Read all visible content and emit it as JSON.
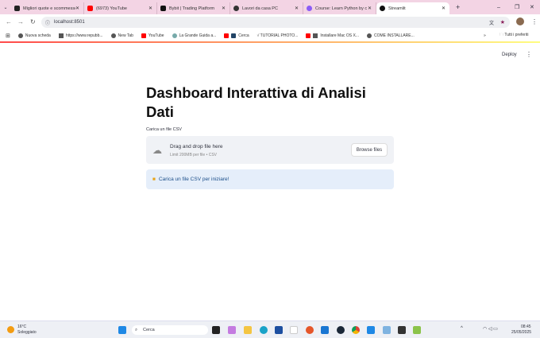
{
  "browser": {
    "tabs": [
      {
        "title": "Migliori quote e scommesse",
        "color": "#222"
      },
      {
        "title": "(6973) YouTube",
        "color": "#f00"
      },
      {
        "title": "Bybit | Trading Platform",
        "color": "#111"
      },
      {
        "title": "Lavori da casa PC",
        "color": "#333"
      },
      {
        "title": "Course: Learn Python by c",
        "color": "#8b5cf6"
      },
      {
        "title": "Streamlit",
        "color": "#111"
      }
    ],
    "url": "localhost:8501",
    "bookmarks": [
      "Nuova scheda",
      "https://www.repubb...",
      "New Tab",
      "YouTube",
      "La Grande Guida a...",
      "Cerca",
      "√ TUTORIAL PHOTO...",
      "Installare Mac OS X...",
      "COME INSTALLARE..."
    ],
    "all_bookmarks": "Tutti i preferiti"
  },
  "app": {
    "deploy": "Deploy",
    "title": "Dashboard Interattiva di Analisi Dati",
    "uploader_label": "Carica un file CSV",
    "drag_text": "Drag and drop file here",
    "limit_text": "Limit 200MB per file • CSV",
    "browse": "Browse files",
    "info": "Carica un file CSV per iniziare!"
  },
  "taskbar": {
    "temp": "16°C",
    "weather": "Soleggiato",
    "search": "Cerca",
    "time": "08:45",
    "date": "25/05/2025"
  }
}
